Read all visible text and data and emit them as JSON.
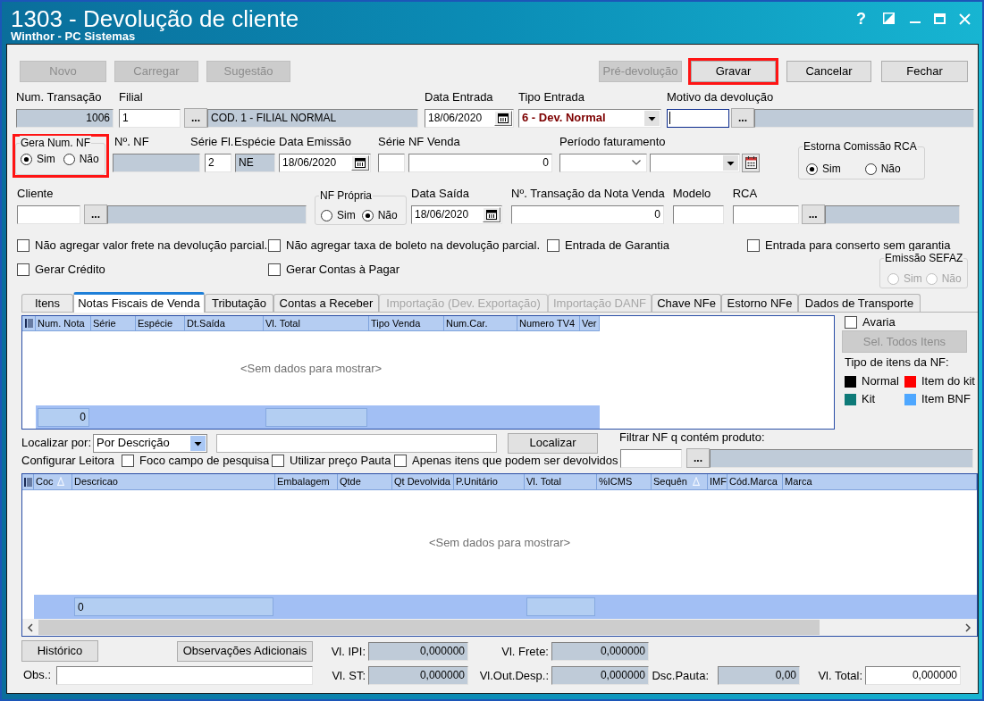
{
  "window": {
    "title": "1303 - Devolução de cliente",
    "subtitle": "Winthor - PC Sistemas",
    "help_button": "?"
  },
  "toolbar": {
    "left": [
      {
        "label": "Novo",
        "disabled": true,
        "highlighted": false
      },
      {
        "label": "Carregar",
        "disabled": true,
        "highlighted": false
      },
      {
        "label": "Sugestão",
        "disabled": true,
        "highlighted": false
      }
    ],
    "right": [
      {
        "label": "Pré-devolução",
        "disabled": true,
        "highlighted": false
      },
      {
        "label": "Gravar",
        "disabled": false,
        "highlighted": true
      },
      {
        "label": "Cancelar",
        "disabled": false,
        "highlighted": false
      },
      {
        "label": "Fechar",
        "disabled": false,
        "highlighted": false
      }
    ]
  },
  "form": {
    "num_transacao": {
      "label": "Num. Transação",
      "value": "1006"
    },
    "filial": {
      "label": "Filial",
      "value": "1",
      "lookup_button": "...",
      "description": "COD. 1 - FILIAL NORMAL"
    },
    "data_entrada": {
      "label": "Data Entrada",
      "value": "18/06/2020"
    },
    "tipo_entrada": {
      "label": "Tipo Entrada",
      "value": "6 - Dev. Normal"
    },
    "motivo_devolucao": {
      "label": "Motivo da devolução",
      "focused": true,
      "lookup_button": "..."
    },
    "gera_num_nf": {
      "label": "Gera Num. NF",
      "highlighted": true,
      "options": [
        {
          "label": "Sim",
          "selected": true
        },
        {
          "label": "Não",
          "selected": false
        }
      ]
    },
    "num_nf": {
      "label": "Nº. NF"
    },
    "serie_fl": {
      "label": "Série Fl.",
      "value": "2"
    },
    "especie": {
      "label": "Espécie",
      "value": "NE"
    },
    "data_emissao": {
      "label": "Data Emissão",
      "value": "18/06/2020"
    },
    "serie_nf_venda": {
      "label": "Série NF Venda",
      "value_2": "0"
    },
    "periodo_faturamento": {
      "label": "Período faturamento"
    },
    "estorna_comissao_rca": {
      "label": "Estorna Comissão RCA",
      "options": [
        {
          "label": "Sim",
          "selected": true
        },
        {
          "label": "Não",
          "selected": false
        }
      ]
    },
    "cliente": {
      "label": "Cliente",
      "lookup_button": "..."
    },
    "nf_propria": {
      "label": "NF Própria",
      "options": [
        {
          "label": "Sim",
          "selected": false
        },
        {
          "label": "Não",
          "selected": true
        }
      ]
    },
    "data_saida": {
      "label": "Data Saída",
      "value": "18/06/2020"
    },
    "num_transacao_nota_venda": {
      "label": "Nº. Transação da Nota Venda",
      "value": "0"
    },
    "modelo": {
      "label": "Modelo"
    },
    "rca": {
      "label": "RCA",
      "lookup_button": "..."
    }
  },
  "checkbox_rows": [
    [
      {
        "label": "Não agregar valor frete na devolução parcial.",
        "checked": false
      },
      {
        "label": "Não agregar taxa de boleto na devolução parcial.",
        "checked": false
      },
      {
        "label": "Entrada de Garantia",
        "checked": false
      },
      {
        "label": "Entrada para conserto sem garantia",
        "checked": false
      }
    ],
    [
      {
        "label": "Gerar Crédito",
        "checked": false
      },
      {
        "label": "Gerar Contas à Pagar",
        "checked": false
      }
    ]
  ],
  "emissao_sefaz": {
    "label": "Emissão SEFAZ",
    "disabled": true,
    "options": [
      {
        "label": "Sim",
        "selected": false
      },
      {
        "label": "Não",
        "selected": false
      }
    ]
  },
  "tabs": [
    {
      "label": "Itens",
      "selected": false,
      "disabled": false
    },
    {
      "label": "Notas Fiscais de Venda",
      "selected": true,
      "disabled": false
    },
    {
      "label": "Tributação",
      "selected": false,
      "disabled": false
    },
    {
      "label": "Contas a Receber",
      "selected": false,
      "disabled": false
    },
    {
      "label": "Importação (Dev. Exportação)",
      "selected": false,
      "disabled": true
    },
    {
      "label": "Importação DANF",
      "selected": false,
      "disabled": true
    },
    {
      "label": "Chave NFe",
      "selected": false,
      "disabled": false
    },
    {
      "label": "Estorno NFe",
      "selected": false,
      "disabled": false
    },
    {
      "label": "Dados de Transporte",
      "selected": false,
      "disabled": false
    }
  ],
  "notas_grid": {
    "columns": [
      {
        "label": "Num. Nota",
        "has_summary": true,
        "summary_value": "0"
      },
      {
        "label": "Série",
        "has_summary": false
      },
      {
        "label": "Espécie",
        "has_summary": false
      },
      {
        "label": "Dt.Saída",
        "has_summary": false
      },
      {
        "label": "Vl. Total",
        "has_summary": true
      },
      {
        "label": "Tipo Venda",
        "has_summary": false
      },
      {
        "label": "Num.Car.",
        "has_summary": false
      },
      {
        "label": "Numero TV4",
        "has_summary": false
      },
      {
        "label": "Ver",
        "has_summary": false
      }
    ],
    "empty_message": "<Sem dados para mostrar>"
  },
  "side_panel": {
    "avaria": {
      "label": "Avaria",
      "checked": false
    },
    "select_all_button": {
      "label": "Sel. Todos Itens",
      "disabled": true
    },
    "legend_title": "Tipo de itens da NF:",
    "legend": [
      {
        "label": "Normal",
        "color": "#000000"
      },
      {
        "label": "Item do kit",
        "color": "#ff0000"
      },
      {
        "label": "Kit",
        "color": "#0e7a78"
      },
      {
        "label": "Item BNF",
        "color": "#4ea7ff"
      }
    ]
  },
  "search": {
    "label": "Localizar por:",
    "mode": "Por Descrição",
    "button": "Localizar",
    "reader_label": "Configurar Leitora",
    "options": [
      {
        "label": "Foco campo de pesquisa",
        "checked": false
      },
      {
        "label": "Utilizar preço Pauta",
        "checked": false
      },
      {
        "label": "Apenas itens que podem ser devolvidos",
        "checked": false
      }
    ]
  },
  "product_filter": {
    "label": "Filtrar NF q contém produto:",
    "lookup_button": "..."
  },
  "items_grid": {
    "columns": [
      {
        "label": "Coc",
        "sorted": true,
        "has_summary": false
      },
      {
        "label": "Descricao",
        "sorted": false,
        "has_summary": true,
        "summary_value": "0"
      },
      {
        "label": "Embalagem",
        "sorted": false,
        "has_summary": false
      },
      {
        "label": "Qtde",
        "sorted": false,
        "has_summary": false
      },
      {
        "label": "Qt Devolvida",
        "sorted": false,
        "has_summary": false
      },
      {
        "label": "P.Unitário",
        "sorted": false,
        "has_summary": false
      },
      {
        "label": "Vl. Total",
        "sorted": false,
        "has_summary": true
      },
      {
        "label": "%ICMS",
        "sorted": false,
        "has_summary": false
      },
      {
        "label": "Sequên",
        "sorted": true,
        "has_summary": false
      },
      {
        "label": "IMF",
        "sorted": false,
        "has_summary": false
      },
      {
        "label": "Cód.Marca",
        "sorted": false,
        "has_summary": false
      },
      {
        "label": "Marca",
        "sorted": false,
        "has_summary": false
      }
    ],
    "empty_message": "<Sem dados para mostrar>"
  },
  "footer": {
    "buttons": [
      {
        "label": "Histórico"
      },
      {
        "label": "Observações Adicionais"
      }
    ],
    "obs_label": "Obs.:",
    "totals": [
      [
        {
          "label": "Vl. IPI:",
          "value": "0,000000",
          "readonly": true
        },
        {
          "label": "Vl. Frete:",
          "value": "0,000000",
          "readonly": true
        }
      ],
      [
        {
          "label": "Vl. ST:",
          "value": "0,000000",
          "readonly": true
        },
        {
          "label": "Vl.Out.Desp.:",
          "value": "0,000000",
          "readonly": true
        },
        {
          "label": "Dsc.Pauta:",
          "value": "0,00",
          "readonly": true
        },
        {
          "label": "Vl. Total:",
          "value": "0,000000",
          "readonly": false
        }
      ]
    ]
  }
}
